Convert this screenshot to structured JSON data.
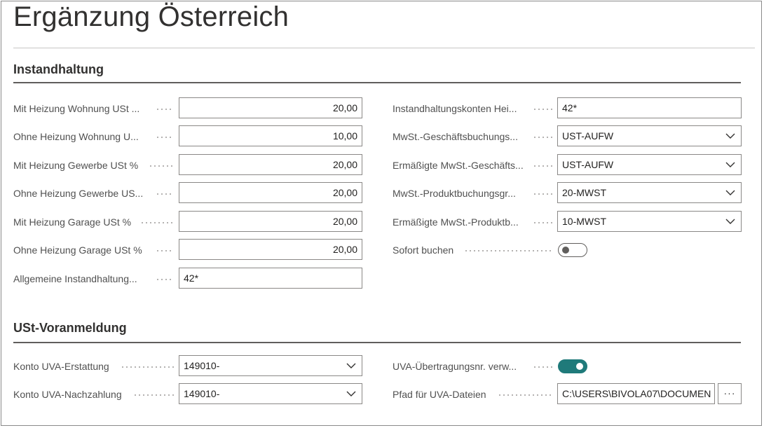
{
  "page": {
    "title": "Ergänzung Österreich"
  },
  "sections": {
    "instandhaltung": {
      "title": "Instandhaltung",
      "left": [
        {
          "label": "Mit Heizung Wohnung USt ...",
          "value": "20,00"
        },
        {
          "label": "Ohne Heizung Wohnung U...",
          "value": "10,00"
        },
        {
          "label": "Mit Heizung Gewerbe USt %",
          "value": "20,00"
        },
        {
          "label": "Ohne Heizung Gewerbe US...",
          "value": "20,00"
        },
        {
          "label": "Mit Heizung Garage USt %",
          "value": "20,00"
        },
        {
          "label": "Ohne Heizung Garage USt %",
          "value": "20,00"
        },
        {
          "label": "Allgemeine Instandhaltung...",
          "value": "42*"
        }
      ],
      "right": [
        {
          "label": "Instandhaltungskonten Hei...",
          "value": "42*"
        },
        {
          "label": "MwSt.-Geschäftsbuchungs...",
          "value": "UST-AUFW"
        },
        {
          "label": "Ermäßigte MwSt.-Geschäfts...",
          "value": "UST-AUFW"
        },
        {
          "label": "MwSt.-Produktbuchungsgr...",
          "value": "20-MWST"
        },
        {
          "label": "Ermäßigte MwSt.-Produktb...",
          "value": "10-MWST"
        },
        {
          "label": "Sofort buchen"
        }
      ]
    },
    "ust": {
      "title": "USt-Voranmeldung",
      "left": [
        {
          "label": "Konto UVA-Erstattung",
          "value": "149010-"
        },
        {
          "label": "Konto UVA-Nachzahlung",
          "value": "149010-"
        }
      ],
      "right": [
        {
          "label": "UVA-Übertragungsnr. verw..."
        },
        {
          "label": "Pfad für UVA-Dateien",
          "value": "C:\\USERS\\BIVOLA07\\DOCUMEN"
        }
      ],
      "assist_label": "···"
    }
  },
  "colors": {
    "toggle_on": "#1f7a7a",
    "border": "#8a8886",
    "section_rule": "#605e5c"
  },
  "icons": {
    "dropdown": "chevron-down-icon"
  }
}
